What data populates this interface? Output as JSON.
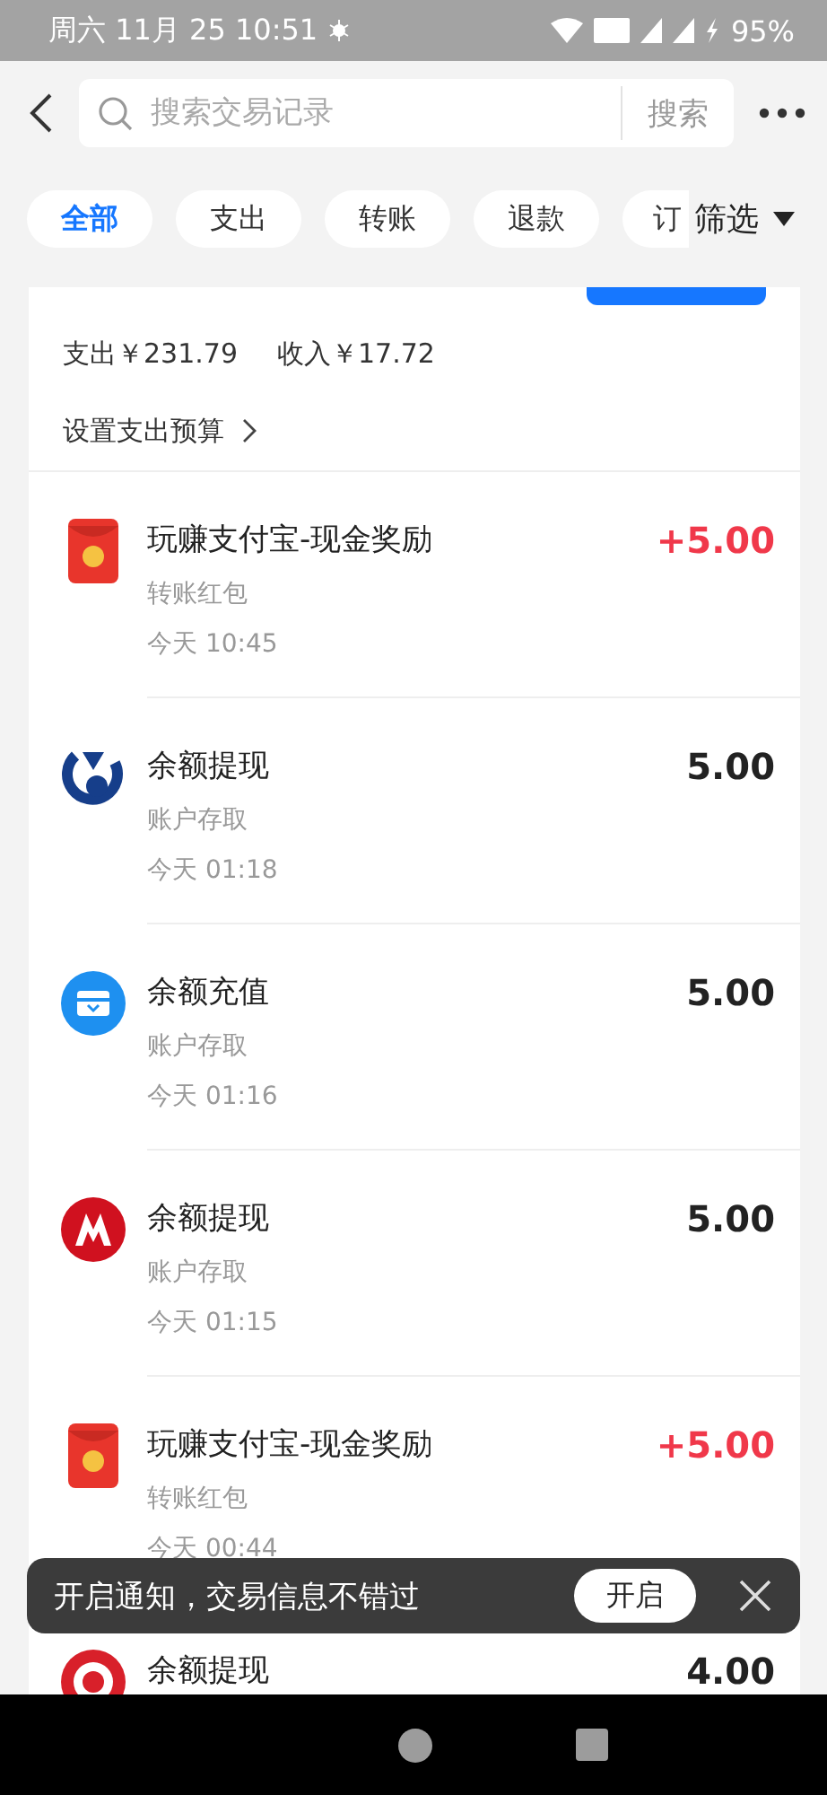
{
  "status_bar": {
    "date_time": "周六 11月 25 10:51",
    "battery": "95%"
  },
  "header": {
    "search": {
      "placeholder": "搜索交易记录"
    },
    "search_button": "搜索"
  },
  "tabs": [
    {
      "label": "全部",
      "selected": true
    },
    {
      "label": "支出",
      "selected": false
    },
    {
      "label": "转账",
      "selected": false
    },
    {
      "label": "退款",
      "selected": false
    },
    {
      "label": "订",
      "selected": false
    }
  ],
  "filter": "筛选",
  "summary": {
    "expense": "支出￥231.79",
    "income": "收入￥17.72",
    "budget_link": "设置支出预算"
  },
  "transactions": [
    {
      "kind": "red-packet",
      "title": "玩赚支付宝-现金奖励",
      "category": "转账红包",
      "time": "今天 10:45",
      "amount": "+5.00",
      "income": true
    },
    {
      "kind": "bank-blue",
      "title": "余额提现",
      "category": "账户存取",
      "time": "今天 01:18",
      "amount": "5.00",
      "income": false
    },
    {
      "kind": "wallet",
      "title": "余额充值",
      "category": "账户存取",
      "time": "今天 01:16",
      "amount": "5.00",
      "income": false
    },
    {
      "kind": "bank-red",
      "title": "余额提现",
      "category": "账户存取",
      "time": "今天 01:15",
      "amount": "5.00",
      "income": false
    },
    {
      "kind": "red-packet",
      "title": "玩赚支付宝-现金奖励",
      "category": "转账红包",
      "time": "今天 00:44",
      "amount": "+5.00",
      "income": true
    },
    {
      "kind": "bank-circle",
      "title": "余额提现",
      "amount": "4.00",
      "income": false
    }
  ],
  "toast": {
    "message": "开启通知，交易信息不错过",
    "button": "开启"
  }
}
